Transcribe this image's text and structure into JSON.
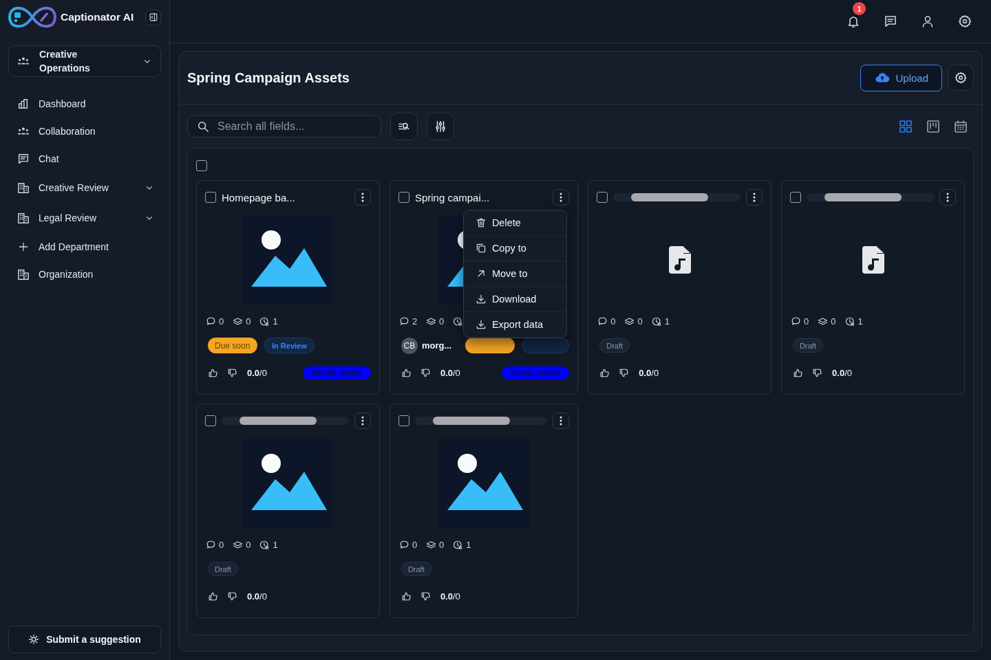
{
  "app": {
    "name": "Captionator AI"
  },
  "workspace": {
    "name": "Creative Operations"
  },
  "nav": [
    {
      "label": "Dashboard",
      "expandable": false
    },
    {
      "label": "Collaboration",
      "expandable": false
    },
    {
      "label": "Chat",
      "expandable": false
    },
    {
      "label": "Creative Review",
      "expandable": true
    },
    {
      "label": "Legal Review",
      "expandable": true
    },
    {
      "label": "Add Department",
      "expandable": false
    },
    {
      "label": "Organization",
      "expandable": false
    }
  ],
  "suggestion_button": "Submit a suggestion",
  "topbar": {
    "notification_count": "1"
  },
  "page": {
    "title": "Spring Campaign Assets",
    "upload_button": "Upload"
  },
  "search": {
    "placeholder": "Search all fields..."
  },
  "views": [
    {
      "kind": "grid",
      "selected": true
    },
    {
      "kind": "board",
      "selected": false
    },
    {
      "kind": "calendar",
      "selected": false
    }
  ],
  "select_all": {
    "checked": false
  },
  "cards": [
    {
      "title": "Homepage ba...",
      "loading": false,
      "checked": false,
      "kind": "image",
      "stats": [
        "0",
        "0",
        "1"
      ],
      "badges": [
        {
          "kind": "due",
          "label": "Due soon"
        },
        {
          "kind": "review",
          "label": "In Review"
        }
      ],
      "rating": "**0.0**/0",
      "review_tag": "Needs review"
    },
    {
      "title": "Spring campai...",
      "loading": false,
      "checked": false,
      "kind": "image",
      "stats": [
        "2",
        "0"
      ],
      "author": {
        "initials": "CB",
        "name": "morg..."
      },
      "badges": [
        {
          "kind": "due"
        },
        {
          "kind": "review"
        }
      ],
      "rating": "**0.0**/0",
      "review_tag": "Needs review",
      "menu": [
        {
          "kind": "delete",
          "label": "Delete"
        },
        {
          "kind": "copy",
          "label": "Copy to"
        },
        {
          "kind": "move",
          "label": "Move to"
        },
        {
          "kind": "download",
          "label": "Download"
        },
        {
          "kind": "download",
          "label": "Export data"
        }
      ]
    },
    {
      "loading": true,
      "checked": false,
      "kind": "audio",
      "stats": [
        "0",
        "0",
        "1"
      ],
      "badges": [
        {
          "kind": "draft",
          "label": "Draft"
        }
      ],
      "rating": "**0.0**/0"
    },
    {
      "loading": true,
      "checked": false,
      "kind": "audio",
      "stats": [
        "0",
        "0",
        "1"
      ],
      "badges": [
        {
          "kind": "draft",
          "label": "Draft"
        }
      ],
      "rating": "**0.0**/0"
    },
    {
      "loading": true,
      "checked": false,
      "kind": "image",
      "stats": [
        "0",
        "0",
        "1"
      ],
      "badges": [
        {
          "kind": "draft",
          "label": "Draft"
        }
      ],
      "rating": "**0.0**/0"
    },
    {
      "loading": true,
      "checked": false,
      "kind": "image",
      "stats": [
        "0",
        "0",
        "1"
      ],
      "badges": [
        {
          "kind": "draft",
          "label": "Draft"
        }
      ],
      "rating": "**0.0**/0"
    }
  ]
}
